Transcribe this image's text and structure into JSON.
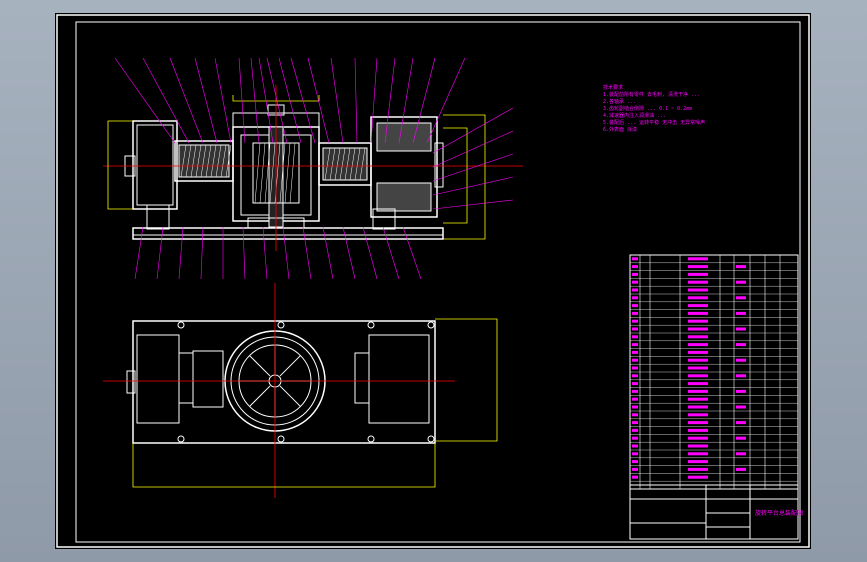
{
  "window": {
    "background_color": "#a7b2bf",
    "drawing_bg": "#000000"
  },
  "colors": {
    "frame": "#ffffff",
    "geometry": "#ffffff",
    "leader": "#ff00ff",
    "dimension": "#ffff00",
    "centerline": "#ff0000",
    "hatch": "#ffffff"
  },
  "technical_notes": {
    "lines": [
      "技术要求",
      "1.装配前所有零件 去毛刺, 清洗干净 ...",
      "2.各轴承 ...",
      "3.齿轮副啮合侧隙 ... 0.1 ~ 0.2mm",
      "4.减速器内注入润滑油 ...",
      "5.装配后 ... 运转平稳 无冲击 无异常噪声",
      "6.外表面 涂漆"
    ]
  },
  "title_block": {
    "drawing_name": "旋转平台总装配图"
  }
}
